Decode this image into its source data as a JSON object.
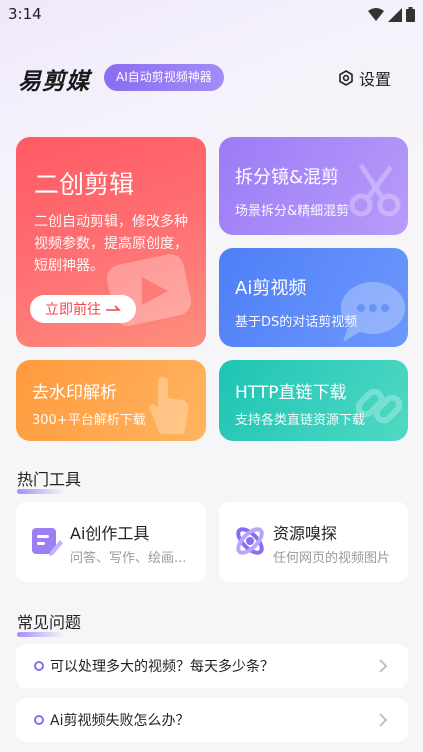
{
  "status": {
    "time": "3:14"
  },
  "header": {
    "logo": "易剪媒",
    "badge": "AI自动剪视频神器",
    "settings_label": "设置"
  },
  "cards": {
    "big": {
      "title": "二创剪辑",
      "desc": "二创自动剪辑，修改多种视频参数，提高原创度，短剧神器。",
      "button": "立即前往"
    },
    "split": {
      "title": "拆分镜&混剪",
      "desc": "场景拆分&精细混剪"
    },
    "ai": {
      "title": "Ai剪视频",
      "desc": "基于DS的对话剪视频"
    },
    "watermark": {
      "title": "去水印解析",
      "desc": "300+平台解析下载"
    },
    "http": {
      "title": "HTTP直链下载",
      "desc": "支持各类直链资源下载"
    }
  },
  "hot_tools": {
    "title": "热门工具",
    "items": [
      {
        "name": "Ai创作工具",
        "sub": "问答、写作、绘画..."
      },
      {
        "name": "资源嗅探",
        "sub": "任何网页的视频图片"
      }
    ]
  },
  "faq": {
    "title": "常见问题",
    "items": [
      {
        "q": "可以处理多大的视频？每天多少条？"
      },
      {
        "q": "Ai剪视频失败怎么办？"
      }
    ]
  },
  "colors": {
    "accent": "#8b6cf2",
    "big_card": "#ff5a63",
    "split_card": "#9b7cf7",
    "ai_card": "#4f7ff8",
    "watermark_card": "#ff9a3e",
    "http_card": "#1fc4b5"
  }
}
